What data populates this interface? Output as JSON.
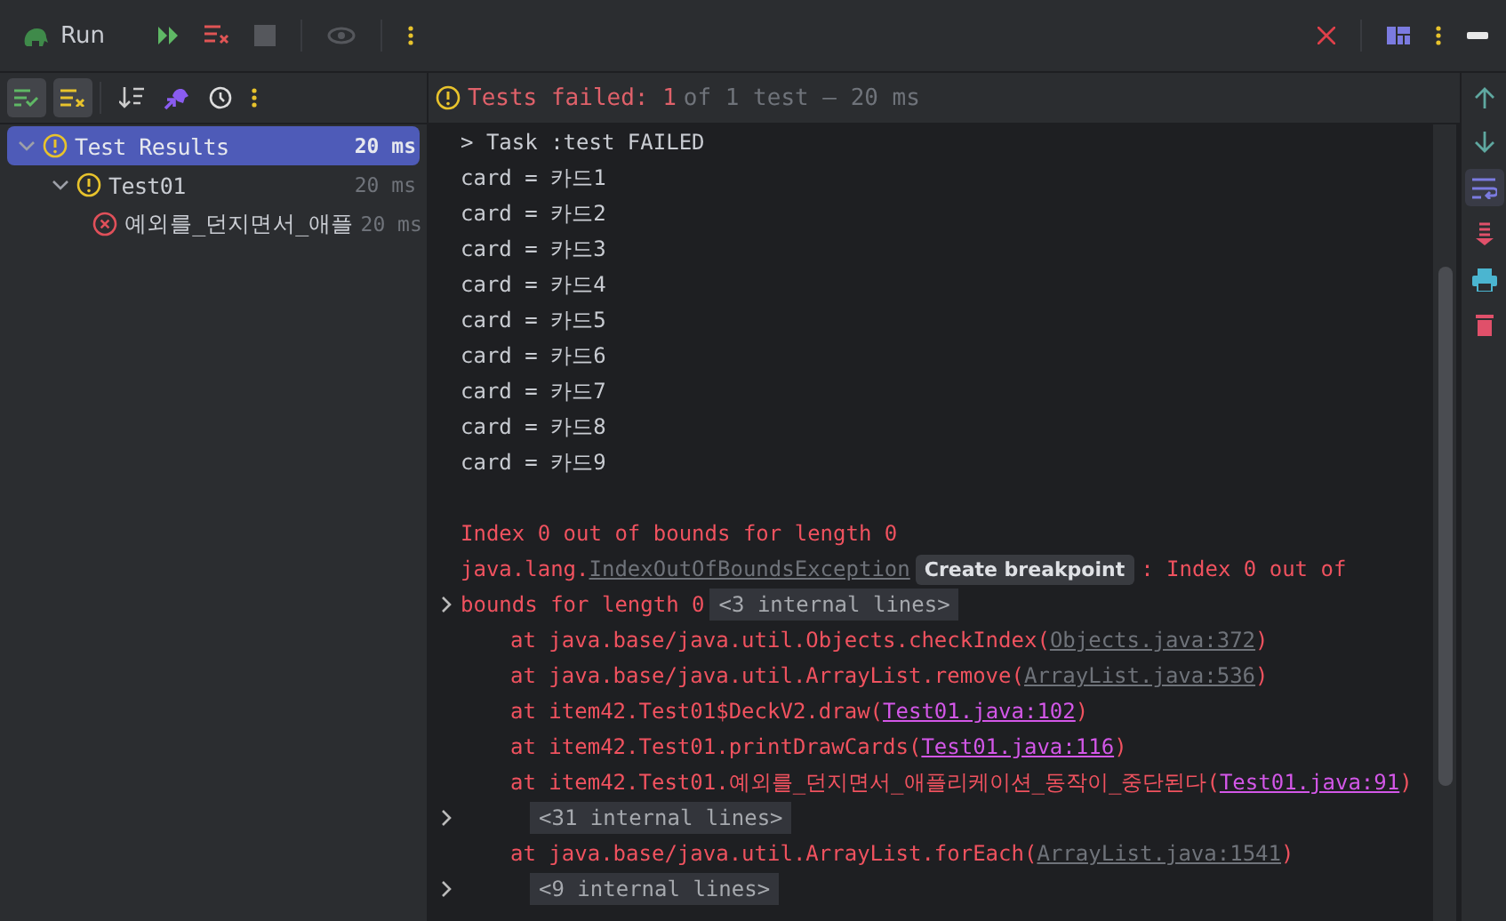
{
  "window": {
    "title": "Run"
  },
  "tool_tabs": [
    {
      "kind": "passed",
      "selected": true
    },
    {
      "kind": "ignored",
      "selected": true
    }
  ],
  "status": {
    "failed_label": "Tests failed: 1",
    "summary": "of 1 test – 20 ms"
  },
  "tree": [
    {
      "label": "Test Results",
      "time": "20 ms",
      "kind": "warning",
      "selected": true,
      "expanded": true,
      "children": [
        {
          "label": "Test01",
          "time": "20 ms",
          "kind": "warning",
          "selected": false,
          "expanded": true,
          "children": [
            {
              "label": "예외를_던지면서_애플",
              "time": "20 ms",
              "kind": "error",
              "selected": false
            }
          ]
        }
      ]
    }
  ],
  "console": [
    {
      "kind": "plain",
      "text": "> Task :test FAILED"
    },
    {
      "kind": "plain",
      "text": "card = 카드1"
    },
    {
      "kind": "plain",
      "text": "card = 카드2"
    },
    {
      "kind": "plain",
      "text": "card = 카드3"
    },
    {
      "kind": "plain",
      "text": "card = 카드4"
    },
    {
      "kind": "plain",
      "text": "card = 카드5"
    },
    {
      "kind": "plain",
      "text": "card = 카드6"
    },
    {
      "kind": "plain",
      "text": "card = 카드7"
    },
    {
      "kind": "plain",
      "text": "card = 카드8"
    },
    {
      "kind": "plain",
      "text": "card = 카드9"
    },
    {
      "kind": "blank"
    },
    {
      "kind": "error",
      "text": "Index 0 out of bounds for length 0"
    },
    {
      "kind": "exception",
      "text": "java.lang.",
      "link": "IndexOutOfBoundsException",
      "badge": "Create breakpoint",
      "suffix": ": Index 0 out of"
    },
    {
      "kind": "fold",
      "text": "bounds for length 0",
      "internal": "<3 internal lines>"
    },
    {
      "kind": "frame",
      "text": "at java.base/java.util.Objects.checkIndex(",
      "link": "Objects.java:372",
      "project": false,
      "suffix": ")"
    },
    {
      "kind": "frame",
      "text": "at java.base/java.util.ArrayList.remove(",
      "link": "ArrayList.java:536",
      "project": false,
      "suffix": ")"
    },
    {
      "kind": "frame",
      "text": "at item42.Test01$DeckV2.draw(",
      "link": "Test01.java:102",
      "project": true,
      "suffix": ")"
    },
    {
      "kind": "frame",
      "text": "at item42.Test01.printDrawCards(",
      "link": "Test01.java:116",
      "project": true,
      "suffix": ")"
    },
    {
      "kind": "frame",
      "text": "at item42.Test01.예외를_던지면서_애플리케이션_동작이_중단된다(",
      "link": "Test01.java:91",
      "project": true,
      "suffix": ")"
    },
    {
      "kind": "fold",
      "internal": "<31 internal lines>"
    },
    {
      "kind": "frame",
      "text": "at java.base/java.util.ArrayList.forEach(",
      "link": "ArrayList.java:1541",
      "project": false,
      "suffix": ")"
    },
    {
      "kind": "fold",
      "internal": "<9 internal lines>"
    }
  ]
}
